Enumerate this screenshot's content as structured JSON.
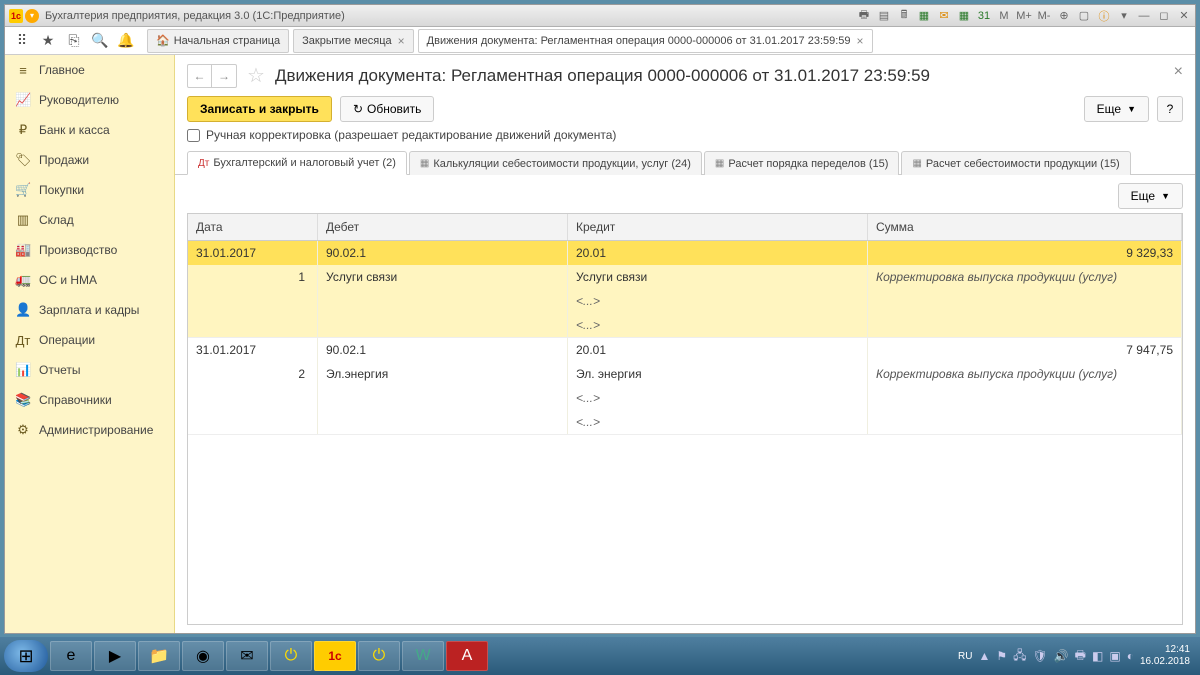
{
  "window_title": "Бухгалтерия предприятия, редакция 3.0  (1С:Предприятие)",
  "top_tabs": {
    "home": "Начальная страница",
    "t1": "Закрытие месяца",
    "t2": "Движения документа: Регламентная операция 0000-000006 от 31.01.2017 23:59:59"
  },
  "sidebar": {
    "items": [
      {
        "icon": "≡",
        "label": "Главное"
      },
      {
        "icon": "📈",
        "label": "Руководителю"
      },
      {
        "icon": "₽",
        "label": "Банк и касса"
      },
      {
        "icon": "🏷",
        "label": "Продажи"
      },
      {
        "icon": "🛒",
        "label": "Покупки"
      },
      {
        "icon": "▥",
        "label": "Склад"
      },
      {
        "icon": "🏭",
        "label": "Производство"
      },
      {
        "icon": "🚛",
        "label": "ОС и НМА"
      },
      {
        "icon": "👤",
        "label": "Зарплата и кадры"
      },
      {
        "icon": "Дт",
        "label": "Операции"
      },
      {
        "icon": "📊",
        "label": "Отчеты"
      },
      {
        "icon": "📚",
        "label": "Справочники"
      },
      {
        "icon": "⚙",
        "label": "Администрирование"
      }
    ]
  },
  "page": {
    "title": "Движения документа: Регламентная операция 0000-000006 от 31.01.2017 23:59:59",
    "save_close": "Записать и закрыть",
    "refresh": "Обновить",
    "more": "Еще",
    "help": "?",
    "checkbox_label": "Ручная корректировка (разрешает редактирование движений документа)"
  },
  "subtabs": {
    "t1": "Бухгалтерский и налоговый учет (2)",
    "t2": "Калькуляции себестоимости продукции, услуг (24)",
    "t3": "Расчет порядка переделов (15)",
    "t4": "Расчет себестоимости продукции (15)"
  },
  "table": {
    "more": "Еще",
    "head": {
      "date": "Дата",
      "debit": "Дебет",
      "credit": "Кредит",
      "sum": "Сумма"
    },
    "rows": [
      {
        "date": "31.01.2017",
        "num": "1",
        "debit": "90.02.1",
        "credit": "20.01",
        "sum": "9 329,33",
        "sub_debit": "Услуги связи",
        "sub_credit": "Услуги связи",
        "desc": "Корректировка выпуска продукции (услуг)",
        "dots": "<...>"
      },
      {
        "date": "31.01.2017",
        "num": "2",
        "debit": "90.02.1",
        "credit": "20.01",
        "sum": "7 947,75",
        "sub_debit": "Эл.энергия",
        "sub_credit": "Эл. энергия",
        "desc": "Корректировка выпуска продукции (услуг)",
        "dots": "<...>"
      }
    ]
  },
  "tray": {
    "lang": "RU",
    "time": "12:41",
    "date": "16.02.2018"
  }
}
